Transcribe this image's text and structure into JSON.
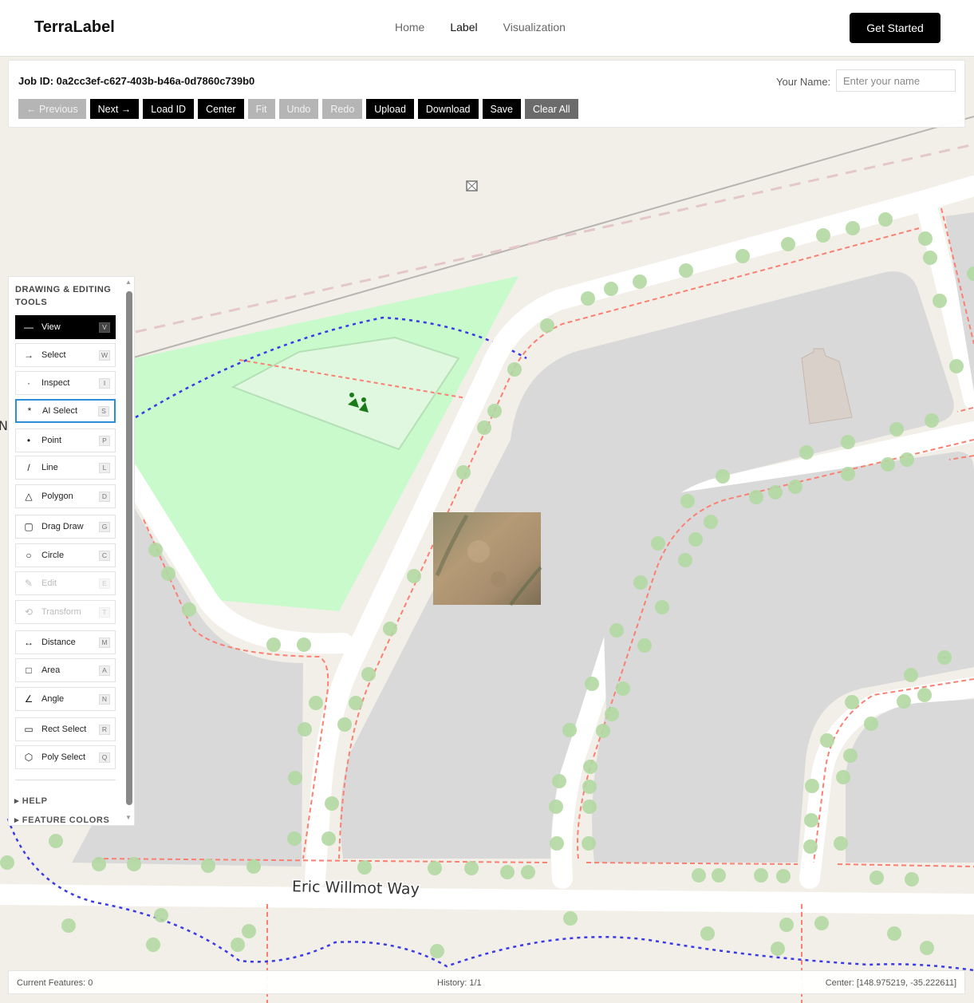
{
  "header": {
    "brand": "TerraLabel",
    "nav": [
      "Home",
      "Label",
      "Visualization"
    ],
    "active_nav": "Label",
    "cta": "Get Started"
  },
  "job": {
    "id_text": "Job ID: 0a2cc3ef-c627-403b-b46a-0d7860c739b0",
    "name_label": "Your Name:",
    "name_placeholder": "Enter your name",
    "name_value": ""
  },
  "toolbar": {
    "buttons": [
      {
        "label": "← Previous",
        "state": "disabled"
      },
      {
        "label": "Next →",
        "state": "enabled"
      },
      {
        "label": "Load ID",
        "state": "enabled"
      },
      {
        "label": "Center",
        "state": "enabled"
      },
      {
        "label": "Fit",
        "state": "disabled"
      },
      {
        "label": "Undo",
        "state": "disabled"
      },
      {
        "label": "Redo",
        "state": "disabled"
      },
      {
        "label": "Upload",
        "state": "enabled"
      },
      {
        "label": "Download",
        "state": "enabled"
      },
      {
        "label": "Save",
        "state": "enabled"
      },
      {
        "label": "Clear All",
        "state": "secondary"
      }
    ]
  },
  "tools": {
    "title": "DRAWING & EDITING TOOLS",
    "items": [
      {
        "label": "View",
        "key": "V",
        "icon": "—",
        "icon_name": "view-icon",
        "state": "selected"
      },
      {
        "label": "Select",
        "key": "W",
        "icon": "→",
        "icon_name": "arrow-icon",
        "state": "normal"
      },
      {
        "label": "Inspect",
        "key": "I",
        "icon": "·",
        "icon_name": "dot-icon",
        "state": "normal"
      },
      {
        "label": "AI Select",
        "key": "S",
        "icon": "*",
        "icon_name": "asterisk-icon",
        "state": "focused"
      },
      {
        "label": "Point",
        "key": "P",
        "icon": "•",
        "icon_name": "point-icon",
        "state": "normal"
      },
      {
        "label": "Line",
        "key": "L",
        "icon": "/",
        "icon_name": "line-icon",
        "state": "normal"
      },
      {
        "label": "Polygon",
        "key": "D",
        "icon": "△",
        "icon_name": "triangle-icon",
        "state": "normal"
      },
      {
        "label": "Drag Draw",
        "key": "G",
        "icon": "▢",
        "icon_name": "rounded-square-icon",
        "state": "normal"
      },
      {
        "label": "Circle",
        "key": "C",
        "icon": "○",
        "icon_name": "circle-icon",
        "state": "normal"
      },
      {
        "label": "Edit",
        "key": "E",
        "icon": "✎",
        "icon_name": "pencil-icon",
        "state": "disabled"
      },
      {
        "label": "Transform",
        "key": "T",
        "icon": "⟲",
        "icon_name": "rotate-icon",
        "state": "disabled"
      },
      {
        "label": "Distance",
        "key": "M",
        "icon": "↔",
        "icon_name": "measure-distance-icon",
        "state": "normal"
      },
      {
        "label": "Area",
        "key": "A",
        "icon": "□",
        "icon_name": "square-icon",
        "state": "normal"
      },
      {
        "label": "Angle",
        "key": "N",
        "icon": "∠",
        "icon_name": "angle-icon",
        "state": "normal"
      },
      {
        "label": "Rect Select",
        "key": "R",
        "icon": "▭",
        "icon_name": "rectangle-icon",
        "state": "normal"
      },
      {
        "label": "Poly Select",
        "key": "Q",
        "icon": "⬡",
        "icon_name": "hexagon-icon",
        "state": "normal"
      }
    ],
    "sections": [
      "▸ HELP",
      "▸ FEATURE COLORS"
    ]
  },
  "map": {
    "street_label": "Eric Willmot Way",
    "edge_label": "N"
  },
  "status": {
    "features": "Current Features: 0",
    "history": "History: 1/1",
    "center": "Center: [148.975219, -35.222611]"
  },
  "colors": {
    "selected_tool_bg": "#000000",
    "ai_select_border": "#2d8ed6",
    "park_fill": "#c8facc",
    "block_fill": "#d9d9d9",
    "sidewalk_dash": "#fa8072",
    "path_dash": "#3a3ae6",
    "tree": "#a9d39a"
  }
}
